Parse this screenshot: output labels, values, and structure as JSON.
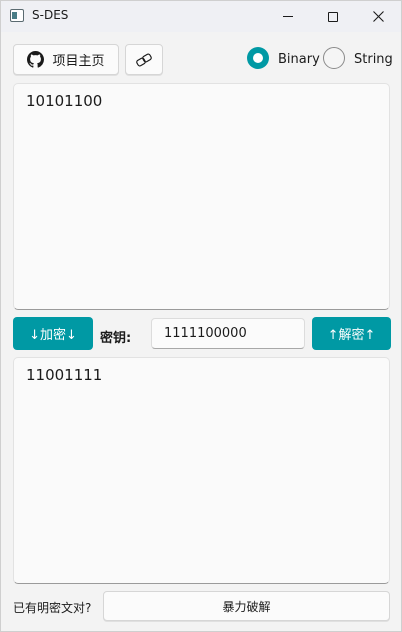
{
  "window": {
    "title": "S-DES"
  },
  "toolbar": {
    "home_label": "项目主页",
    "mode_options": [
      {
        "label": "Binary",
        "selected": true
      },
      {
        "label": "String",
        "selected": false
      }
    ]
  },
  "input": {
    "value": "10101100"
  },
  "actions": {
    "encrypt_label": "↓加密↓",
    "decrypt_label": "↑解密↑",
    "key_label": "密钥:",
    "key_value": "1111100000"
  },
  "output": {
    "value": "11001111"
  },
  "bottom": {
    "question_label": "已有明密文对?",
    "brute_force_label": "暴力破解"
  },
  "colors": {
    "accent": "#0099a4",
    "background": "#f3f3f3",
    "titlebar": "#eff0f4"
  },
  "icons": {
    "app": "app-window-icon",
    "home": "github-icon",
    "link": "link-icon",
    "minimize": "minimize-icon",
    "maximize": "maximize-icon",
    "close": "close-icon"
  }
}
